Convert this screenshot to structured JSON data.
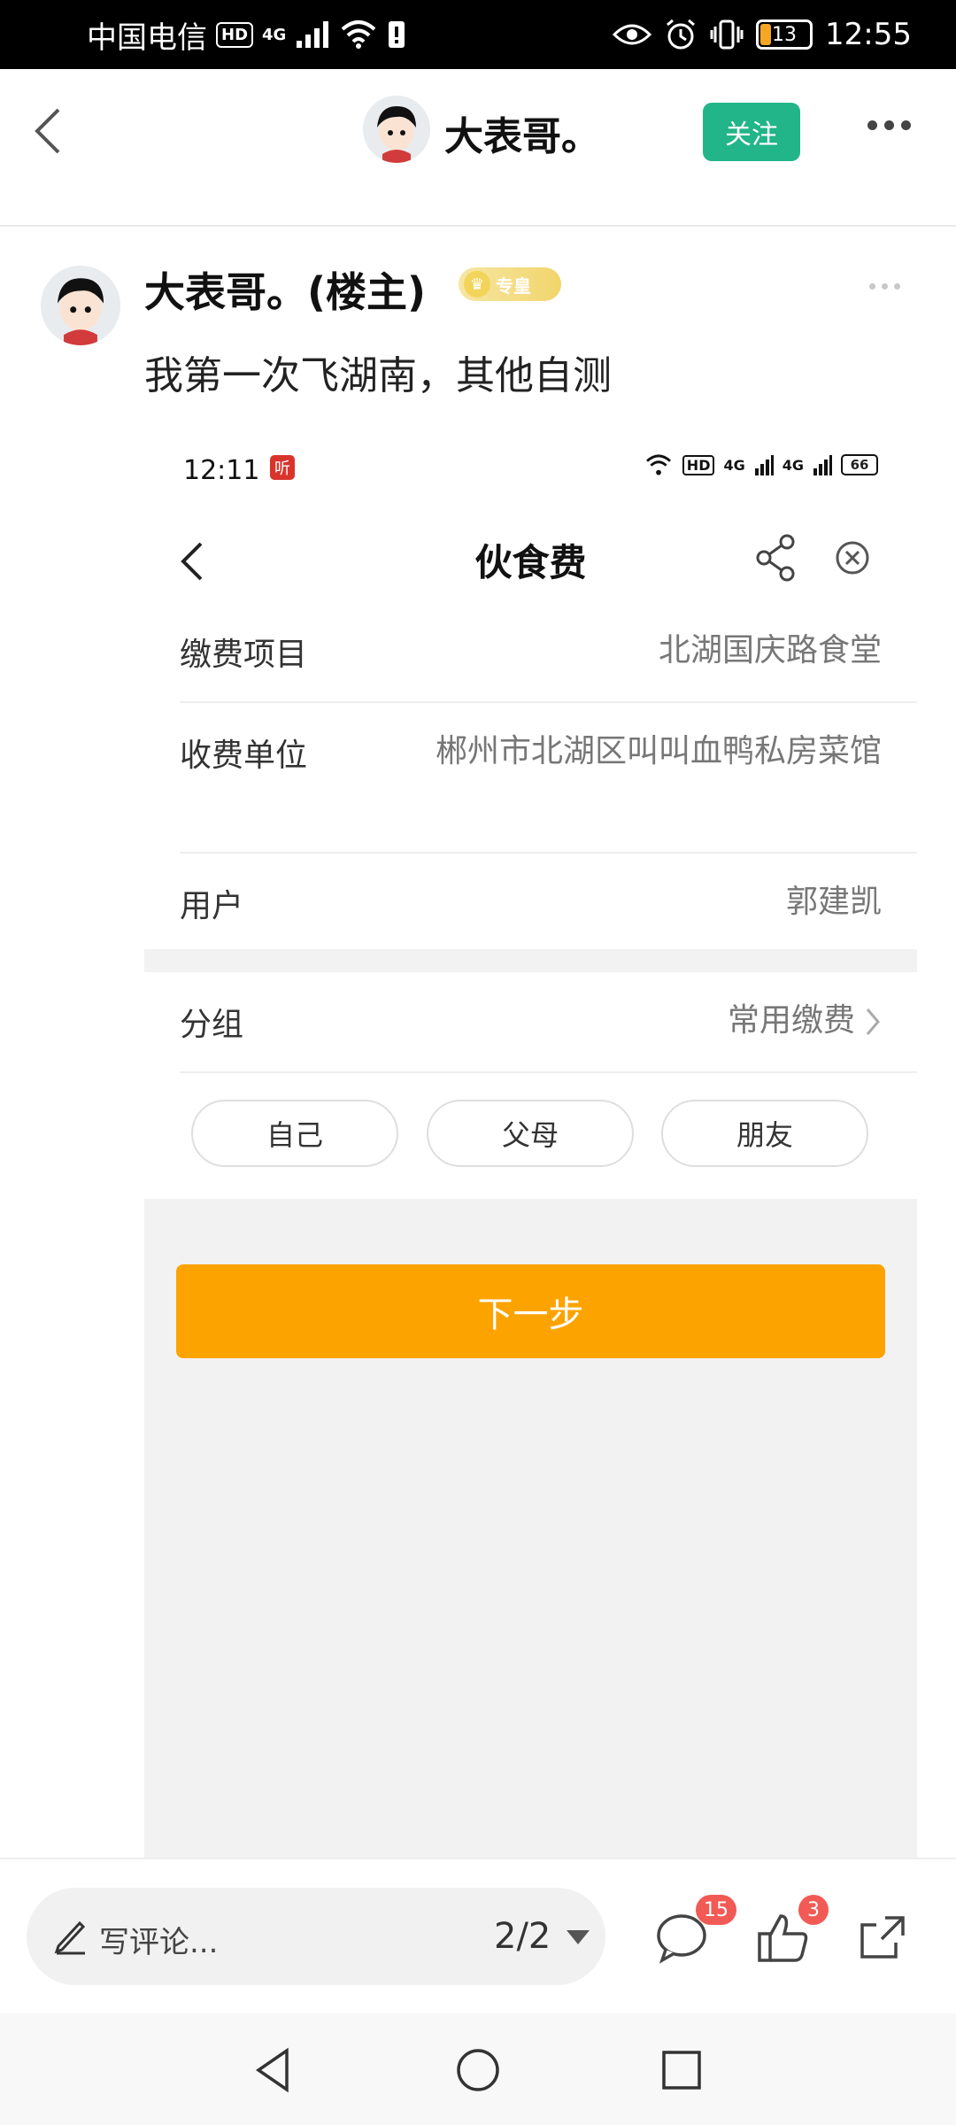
{
  "status_bar": {
    "carrier": "中国电信",
    "hd": "HD",
    "network": "4G",
    "battery": "13",
    "time": "12:55"
  },
  "nav": {
    "title": "大表哥。",
    "follow_label": "关注"
  },
  "post": {
    "author": "大表哥。(楼主)",
    "badge": "专皇",
    "text": "我第一次飞湖南，其他自测"
  },
  "screenshot": {
    "status": {
      "time": "12:11",
      "app_glyph": "听",
      "hd": "HD",
      "net1": "4G",
      "net2": "4G",
      "battery": "66"
    },
    "title": "伙食费",
    "rows": [
      {
        "label": "缴费项目",
        "value": "北湖国庆路食堂"
      },
      {
        "label": "收费单位",
        "value": "郴州市北湖区叫叫血鸭私房菜馆"
      },
      {
        "label": "用户",
        "value": "郭建凯"
      }
    ],
    "group": {
      "label": "分组",
      "value": "常用缴费"
    },
    "chips": [
      "自己",
      "父母",
      "朋友"
    ],
    "next_label": "下一步"
  },
  "bottom": {
    "comment_placeholder": "写评论...",
    "page": "2/2",
    "comment_count": "15",
    "like_count": "3"
  },
  "colors": {
    "follow": "#21b589",
    "next": "#fca300",
    "badge": "#f25a55"
  }
}
